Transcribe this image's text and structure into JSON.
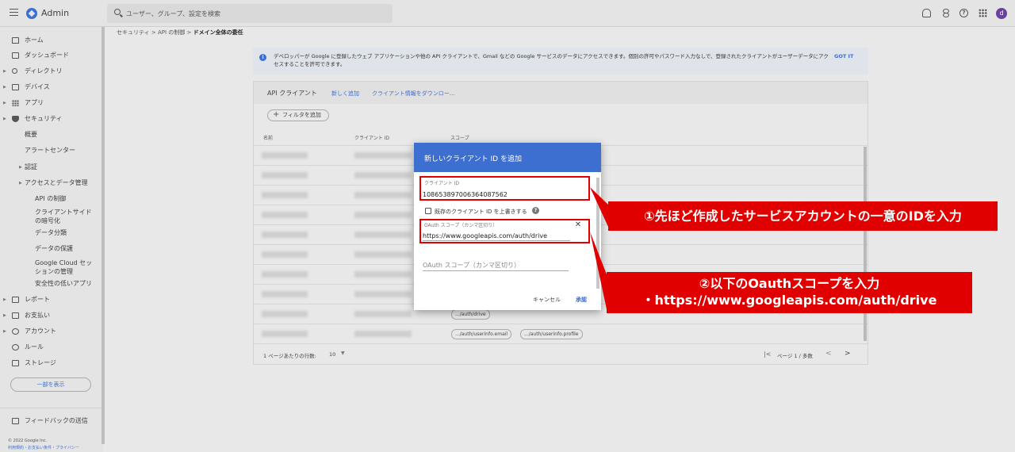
{
  "topbar": {
    "app_name": "Admin",
    "search_placeholder": "ユーザー、グループ、設定を検索",
    "avatar_letter": "d"
  },
  "sidebar": {
    "items": [
      {
        "label": "ホーム",
        "level": 0,
        "arrow": false,
        "icon": "home-icon"
      },
      {
        "label": "ダッシュボード",
        "level": 0,
        "arrow": false,
        "icon": "dashboard-icon"
      },
      {
        "label": "ディレクトリ",
        "level": 0,
        "arrow": true,
        "icon": "person-icon"
      },
      {
        "label": "デバイス",
        "level": 0,
        "arrow": true,
        "icon": "devices-icon"
      },
      {
        "label": "アプリ",
        "level": 0,
        "arrow": true,
        "icon": "apps-grid-icon"
      },
      {
        "label": "セキュリティ",
        "level": 0,
        "arrow": true,
        "icon": "shield-icon"
      },
      {
        "label": "概要",
        "level": 1
      },
      {
        "label": "アラートセンター",
        "level": 1
      },
      {
        "label": "認証",
        "level": 1,
        "arrow": true
      },
      {
        "label": "アクセスとデータ管理",
        "level": 1,
        "arrow": true
      },
      {
        "label": "API の制御",
        "level": 2
      },
      {
        "label": "クライアントサイドの暗号化",
        "level": 2
      },
      {
        "label": "データ分類",
        "level": 2
      },
      {
        "label": "データの保護",
        "level": 2
      },
      {
        "label": "Google Cloud セッションの管理",
        "level": 2
      },
      {
        "label": "安全性の低いアプリ",
        "level": 2
      },
      {
        "label": "レポート",
        "level": 0,
        "arrow": true,
        "icon": "bar-chart-icon"
      },
      {
        "label": "お支払い",
        "level": 0,
        "arrow": true,
        "icon": "credit-card-icon"
      },
      {
        "label": "アカウント",
        "level": 0,
        "arrow": true,
        "icon": "at-sign-icon"
      },
      {
        "label": "ルール",
        "level": 0,
        "arrow": false,
        "icon": "rules-icon"
      },
      {
        "label": "ストレージ",
        "level": 0,
        "arrow": false,
        "icon": "cloud-icon"
      }
    ],
    "show_partial_button": "一部を表示",
    "feedback": "フィードバックの送信",
    "copyright": "© 2022 Google Inc.",
    "terms": "利用規約・お支払い条件・プライバシー"
  },
  "breadcrumb": {
    "items": [
      "セキュリティ",
      "API の制御"
    ],
    "current": "ドメイン全体の委任",
    "separator": ">"
  },
  "info_banner": {
    "text": "デベロッパーが Google に登録したウェブ アプリケーションや他の API クライアントで、Gmail などの Google サービスのデータにアクセスできます。個別の許可やパスワード入力なしで、登録されたクライアントがユーザーデータにアクセスすることを許可できます。",
    "action": "GOT IT"
  },
  "card": {
    "title": "API クライアント",
    "add_new": "新しく追加",
    "download": "クライアント情報をダウンロー...",
    "filter": "フィルタを追加",
    "columns": [
      "名前",
      "クライアント ID",
      "スコープ"
    ],
    "rows": [
      {
        "chips": []
      },
      {
        "chips": []
      },
      {
        "chips": []
      },
      {
        "chips": []
      },
      {
        "chips": []
      },
      {
        "chips": []
      },
      {
        "chips": []
      },
      {
        "chips": []
      },
      {
        "chips": [
          ".../auth/drive"
        ]
      },
      {
        "chips": [
          ".../auth/userinfo.email",
          ".../auth/userinfo.profile"
        ]
      }
    ],
    "rows_per_page_label": "1 ページあたりの行数:",
    "rows_per_page_value": "10",
    "page_label": "ページ 1 / 多数"
  },
  "dialog": {
    "title": "新しいクライアント ID を追加",
    "client_id_label": "クライアント ID",
    "client_id_value": "108653897006364087562",
    "overwrite_label": "既存のクライアント ID を上書きする",
    "overwrite_checked": false,
    "scope_label": "OAuth スコープ（カンマ区切り）",
    "scope_value": "https://www.googleapis.com/auth/drive",
    "scope2_placeholder": "OAuth スコープ（カンマ区切り）",
    "cancel": "キャンセル",
    "approve": "承認"
  },
  "annotations": {
    "callout1": "①先ほど作成したサービスアカウントの一意のIDを入力",
    "callout2_line1": "②以下のOauthスコープを入力",
    "callout2_line2": "・https://www.googleapis.com/auth/drive",
    "accent": "#e00000"
  },
  "colors": {
    "primary": "#3d6fd1",
    "avatar": "#6b3fa0"
  }
}
